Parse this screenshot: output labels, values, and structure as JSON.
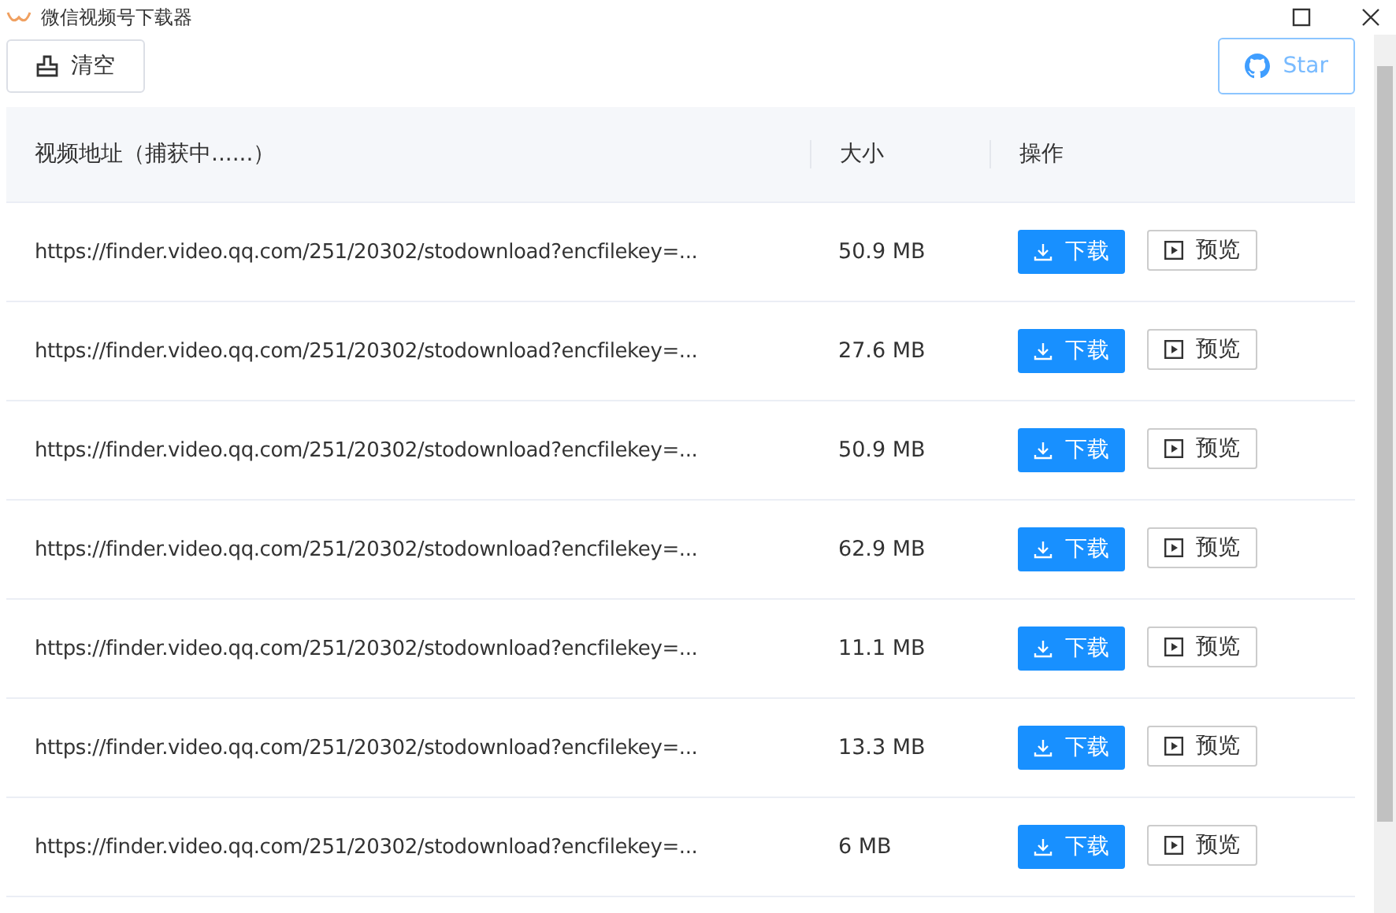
{
  "window": {
    "title": "微信视频号下载器"
  },
  "toolbar": {
    "clear_button": "清空",
    "star_button": "Star"
  },
  "table": {
    "columns": [
      "视频地址（捕获中......）",
      "大小",
      "操作"
    ],
    "rows": [
      {
        "url": "https://finder.video.qq.com/251/20302/stodownload?encfilekey=...",
        "size": "50.9 MB",
        "download": "下载",
        "preview": "预览"
      },
      {
        "url": "https://finder.video.qq.com/251/20302/stodownload?encfilekey=...",
        "size": "27.6 MB",
        "download": "下载",
        "preview": "预览"
      },
      {
        "url": "https://finder.video.qq.com/251/20302/stodownload?encfilekey=...",
        "size": "50.9 MB",
        "download": "下载",
        "preview": "预览"
      },
      {
        "url": "https://finder.video.qq.com/251/20302/stodownload?encfilekey=...",
        "size": "62.9 MB",
        "download": "下载",
        "preview": "预览"
      },
      {
        "url": "https://finder.video.qq.com/251/20302/stodownload?encfilekey=...",
        "size": "11.1 MB",
        "download": "下载",
        "preview": "预览"
      },
      {
        "url": "https://finder.video.qq.com/251/20302/stodownload?encfilekey=...",
        "size": "13.3 MB",
        "download": "下载",
        "preview": "预览"
      },
      {
        "url": "https://finder.video.qq.com/251/20302/stodownload?encfilekey=...",
        "size": "6 MB",
        "download": "下载",
        "preview": "预览"
      }
    ]
  }
}
